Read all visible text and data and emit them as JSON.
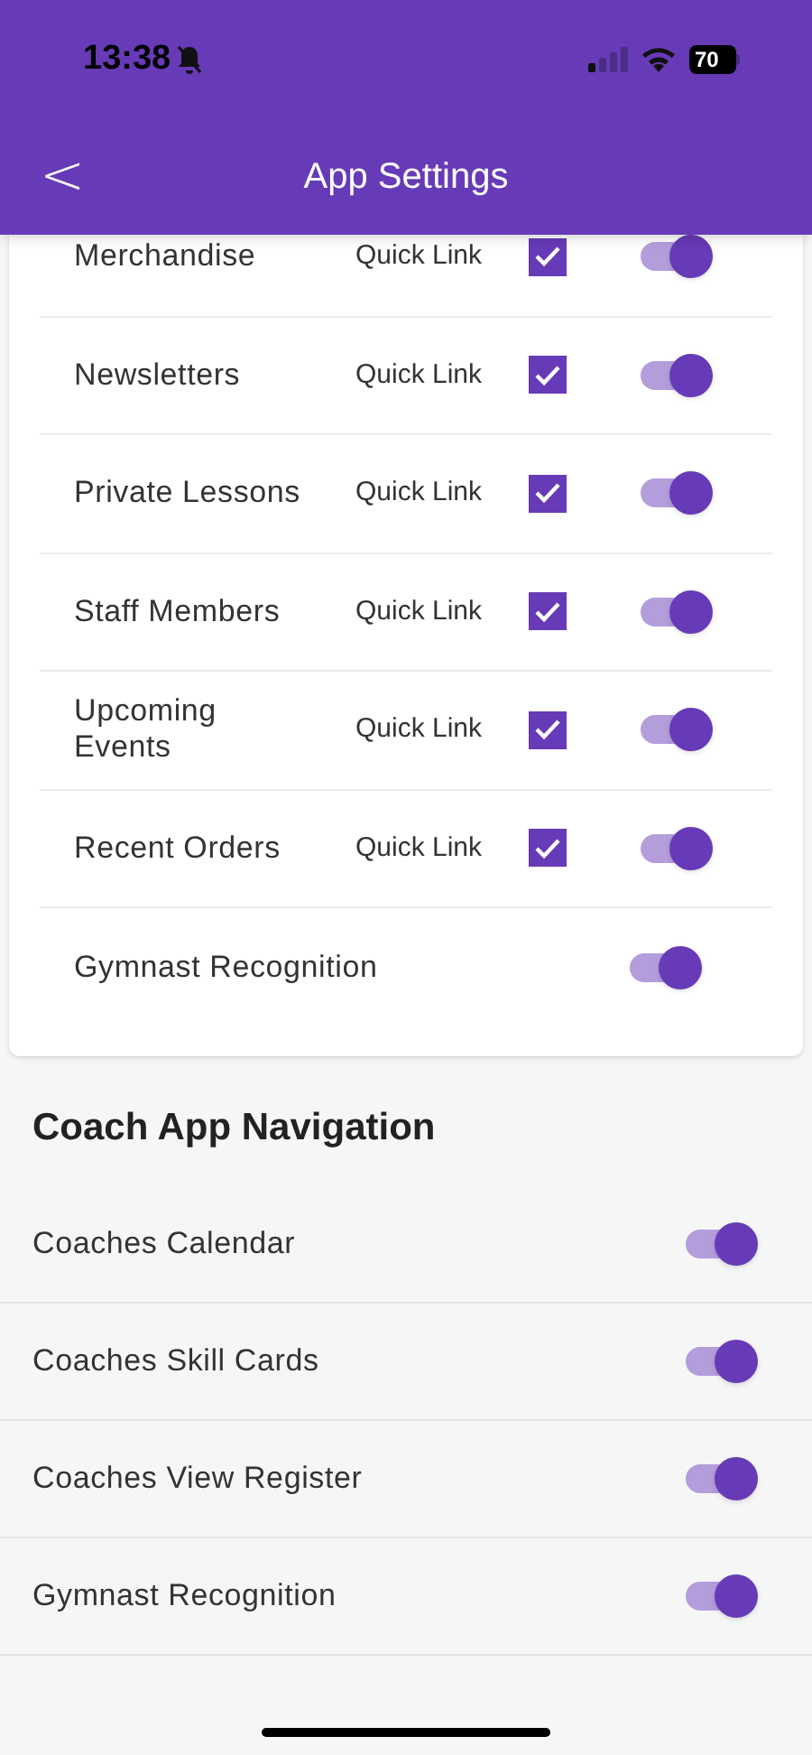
{
  "status_bar": {
    "time": "13:38",
    "battery": "70"
  },
  "header": {
    "title": "App Settings",
    "back": "<"
  },
  "member_items": [
    {
      "kind": "quick_link",
      "label": "Merchandise",
      "quick_link": "Quick Link",
      "checked": true,
      "on": true
    },
    {
      "kind": "quick_link",
      "label": "Newsletters",
      "quick_link": "Quick Link",
      "checked": true,
      "on": true
    },
    {
      "kind": "quick_link",
      "label": "Private Lessons",
      "quick_link": "Quick Link",
      "checked": true,
      "on": true
    },
    {
      "kind": "quick_link",
      "label": "Staff Members",
      "quick_link": "Quick Link",
      "checked": true,
      "on": true
    },
    {
      "kind": "quick_link",
      "label": "Upcoming Events",
      "quick_link": "Quick Link",
      "checked": true,
      "on": true
    },
    {
      "kind": "quick_link",
      "label": "Recent Orders",
      "quick_link": "Quick Link",
      "checked": true,
      "on": true
    },
    {
      "kind": "plain",
      "label": "Gymnast Recognition",
      "on": true
    }
  ],
  "coach_section": {
    "title": "Coach App Navigation",
    "items": [
      {
        "label": "Coaches Calendar",
        "on": true
      },
      {
        "label": "Coaches Skill Cards",
        "on": true
      },
      {
        "label": "Coaches View Register",
        "on": true
      },
      {
        "label": "Gymnast Recognition",
        "on": true
      }
    ]
  }
}
